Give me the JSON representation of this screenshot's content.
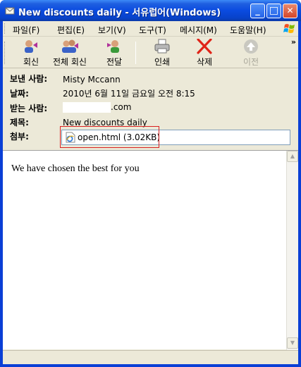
{
  "window": {
    "title": "New discounts daily - 서유럽어(Windows)",
    "minimize_glyph": "_",
    "maximize_glyph": "□",
    "close_glyph": "✕"
  },
  "menu": [
    "파일(F)",
    "편집(E)",
    "보기(V)",
    "도구(T)",
    "메시지(M)",
    "도움말(H)"
  ],
  "toolbar": {
    "reply": "회신",
    "reply_all": "전체 회신",
    "forward": "전달",
    "print": "인쇄",
    "delete": "삭제",
    "previous": "이전",
    "overflow": "»"
  },
  "headers": {
    "from_label": "보낸 사람:",
    "from_value": "Misty Mccann",
    "date_label": "날짜:",
    "date_value": "2010년 6월 11일 금요일 오전 8:15",
    "to_label": "받는 사람:",
    "to_value_suffix": ".com",
    "subject_label": "제목:",
    "subject_value": "New discounts daily",
    "attachment_label": "첨부:",
    "attachment_value": "open.html (3.02KB)"
  },
  "message": {
    "body": "We have chosen the best for you"
  },
  "colors": {
    "titlebar": "#0a4be0",
    "chrome": "#ece9d8",
    "attachment_highlight": "#d92020"
  }
}
